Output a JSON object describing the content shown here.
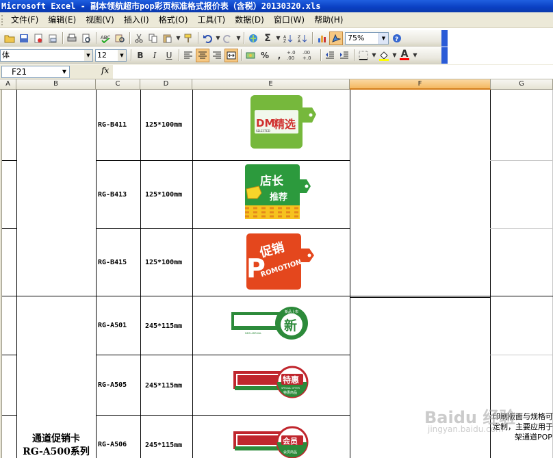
{
  "window": {
    "title": "Microsoft Excel - 副本领航超市pop彩页标准格式报价表（含税）20130320.xls"
  },
  "menu": [
    "文件(F)",
    "编辑(E)",
    "视图(V)",
    "插入(I)",
    "格式(O)",
    "工具(T)",
    "数据(D)",
    "窗口(W)",
    "帮助(H)"
  ],
  "toolbar": {
    "zoom": "75%",
    "font_name": "体",
    "font_size": "12",
    "bold": "B",
    "italic": "I",
    "underline": "U",
    "percent": "%",
    "comma": ",",
    "inc_decimal": "+.0 .00",
    "dec_decimal": ".00 +.0",
    "font_color_label": "A"
  },
  "formula": {
    "cell_ref": "F21",
    "fx": "fx",
    "value": ""
  },
  "columns": [
    "A",
    "B",
    "C",
    "D",
    "E",
    "F",
    "G"
  ],
  "products": [
    {
      "code": "RG-B411",
      "size": "125*100mm",
      "image": {
        "label1": "DM",
        "label2": "精选",
        "label3": "SELECTED",
        "bg": "#76b83c"
      }
    },
    {
      "code": "RG-B413",
      "size": "125*100mm",
      "image": {
        "label1": "店长",
        "label2": "推荐",
        "bg": "#2c9a3d"
      }
    },
    {
      "code": "RG-B415",
      "size": "125*100mm",
      "image": {
        "label1": "促销",
        "label2": "ROMOTION",
        "label3": "P",
        "bg": "#e4471d"
      }
    },
    {
      "code": "RG-A501",
      "size": "245*115mm",
      "image": {
        "label1": "新",
        "label2": "NEW ARRIVAL",
        "label3": "新品上市",
        "bg": "#2c8a3a"
      }
    },
    {
      "code": "RG-A505",
      "size": "245*115mm",
      "image": {
        "label1": "特惠",
        "label2": "SPECIAL OFFER",
        "label3": "特惠商品",
        "bg": "#c0262d"
      }
    },
    {
      "code": "RG-A506",
      "size": "245*115mm",
      "image": {
        "label1": "会员",
        "label2": "会员商品",
        "bg": "#c0262d"
      }
    }
  ],
  "series_label": {
    "line1": "通道促销卡",
    "line2": "RG-A500系列"
  },
  "side_note": {
    "line1": "印刷版面与规格可",
    "line2": "定制，主要应用于",
    "line3": "架通道POP"
  },
  "watermark": {
    "brand": "Baidu 经验",
    "sub": "jingyan.baidu.com"
  }
}
